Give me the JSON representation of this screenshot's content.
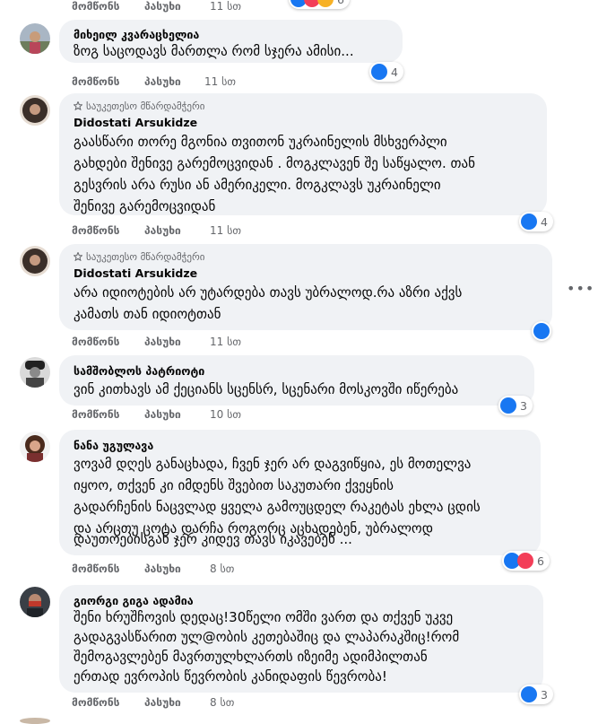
{
  "actions": {
    "like": "მომწონს",
    "reply": "პასუხი"
  },
  "top_partial": {
    "time": "11 სთ",
    "reactions": "6"
  },
  "comments": [
    {
      "author": "მიხეილ კვარაცხელია",
      "badge": "",
      "lines": [
        "ზოგ საცოდავს მართლა რომ სჯერა ამისი..."
      ],
      "reactions": "4",
      "time": "11 სთ"
    },
    {
      "author": "Didostati Arsukidze",
      "badge": "საუკეთესო მწარდამჭერი",
      "lines": [
        "გაასწარი თორე მგონია თვითონ უკრაინელის მსხვერპლი",
        "გახდები შენივე გარემოცვიდან . მოგკლავენ შე საწყალო. თან",
        "გესვრის არა რუსი ან ამერიკელი. მოგკლავს უკრაინელი",
        "შენივე გარემოცვიდან"
      ],
      "reactions": "4",
      "time": "11 სთ"
    },
    {
      "author": "Didostati Arsukidze",
      "badge": "საუკეთესო მწარდამჭერი",
      "lines": [
        "არა იდიოტების არ უტარდება თავს უბრალოდ.რა აზრი აქვს",
        "კამათს თან იდიოტთან"
      ],
      "reactions": "",
      "time": "11 სთ"
    },
    {
      "author": "სამშობლოს პატრიოტი",
      "badge": "",
      "lines": [
        "ვინ კითხავს ამ ქეციანს სცენსრ, სცენარი მოსკოვში იწერება"
      ],
      "reactions": "3",
      "time": "10 სთ"
    },
    {
      "author": "ნანა უგულავა",
      "badge": "",
      "lines": [
        "ვოვამ დღეს განაცხადა, ჩვენ ჯერ არ დაგვიწყია, ეს მოთელვა",
        "იყოო, თქვენ კი იმდენს შვებით საკუთარი ქვეყნის",
        "გადარჩენის ნაცვლად ყველა გამოუცდელ რაკეტას ეხლა ცდის",
        "და არცთუ ცოტა დარჩა როგორც აცხადებენ, უბრალოდ",
        "დაუთოებისგან ჯერ კიდევ თავს იკავებენ ..."
      ],
      "reactions": "6",
      "time": "8 სთ"
    },
    {
      "author": "გიორგი გიგა ადამია",
      "badge": "",
      "lines": [
        "შენი ხრუშჩოვის დედაც!30წელი ომში ვართ და თქვენ უკვე",
        "გადაგვასწარით ულ@ობის კეთებაშიც და ლაპარაკშიც!რომ",
        "შემოგავლებენ მავრთულხლართს იზეიმე ადიმპილთან",
        "ერთად ევროპის წევრობის კანიდაფის წევრობა!"
      ],
      "reactions": "3",
      "time": "8 სთ"
    }
  ],
  "colors": {
    "like_blue": "#1877f2",
    "love_red": "#f33e58",
    "haha_yellow": "#f7b125",
    "bubble": "#f0f2f5",
    "meta": "#65676b"
  }
}
